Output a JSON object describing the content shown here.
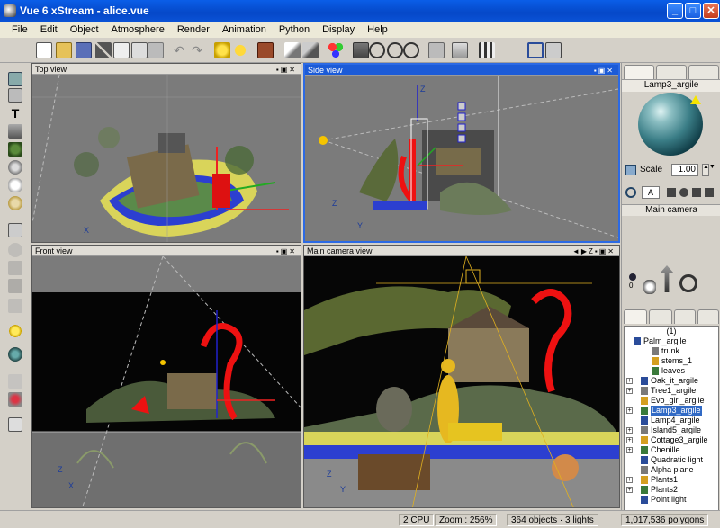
{
  "window": {
    "title": "Vue 6 xStream - alice.vue",
    "min": "_",
    "max": "□",
    "close": "✕"
  },
  "menu": [
    "File",
    "Edit",
    "Object",
    "Atmosphere",
    "Render",
    "Animation",
    "Python",
    "Display",
    "Help"
  ],
  "viewports": {
    "top": {
      "label": "Top view"
    },
    "side": {
      "label": "Side view"
    },
    "front": {
      "label": "Front view"
    },
    "main": {
      "label": "Main camera view"
    }
  },
  "axis_labels": {
    "x": "X",
    "y": "Y",
    "z": "Z"
  },
  "material": {
    "name": "Lamp3_argile",
    "scale_label": "Scale",
    "scale_value": "1.00",
    "mode_label": "A"
  },
  "camera": {
    "title": "Main camera",
    "indicator": "0"
  },
  "tree": {
    "header": "(1)",
    "items": [
      {
        "label": "Palm_argile",
        "expander": "",
        "indent": 10,
        "selected": false
      },
      {
        "label": "trunk",
        "expander": "",
        "indent": 30,
        "selected": false
      },
      {
        "label": "stems_1",
        "expander": "",
        "indent": 30,
        "selected": false
      },
      {
        "label": "leaves",
        "expander": "",
        "indent": 30,
        "selected": false
      },
      {
        "label": "Oak_it_argile",
        "expander": "+",
        "indent": 18,
        "selected": false
      },
      {
        "label": "Tree1_argile",
        "expander": "+",
        "indent": 18,
        "selected": false
      },
      {
        "label": "Evo_girl_argile",
        "expander": "",
        "indent": 18,
        "selected": false
      },
      {
        "label": "Lamp3_argile",
        "expander": "+",
        "indent": 18,
        "selected": true
      },
      {
        "label": "Lamp4_argile",
        "expander": "",
        "indent": 18,
        "selected": false
      },
      {
        "label": "Island5_argile",
        "expander": "+",
        "indent": 18,
        "selected": false
      },
      {
        "label": "Cottage3_argile",
        "expander": "+",
        "indent": 18,
        "selected": false
      },
      {
        "label": "Chenille",
        "expander": "+",
        "indent": 18,
        "selected": false
      },
      {
        "label": "Quadratic light",
        "expander": "",
        "indent": 18,
        "selected": false
      },
      {
        "label": "Alpha plane",
        "expander": "",
        "indent": 18,
        "selected": false
      },
      {
        "label": "Plants1",
        "expander": "+",
        "indent": 18,
        "selected": false
      },
      {
        "label": "Plants2",
        "expander": "+",
        "indent": 18,
        "selected": false
      },
      {
        "label": "Point light",
        "expander": "",
        "indent": 18,
        "selected": false
      }
    ]
  },
  "status": {
    "cpu": "2 CPU",
    "zoom": "Zoom : 256%",
    "objects": "364 objects · 3 lights",
    "polygons": "1,017,536 polygons"
  },
  "colors": {
    "titlebar": "#0548c8",
    "active_viewport": "#1c5bd7",
    "selection": "#316ac5",
    "viewport_bg": "#7d7d7d"
  }
}
